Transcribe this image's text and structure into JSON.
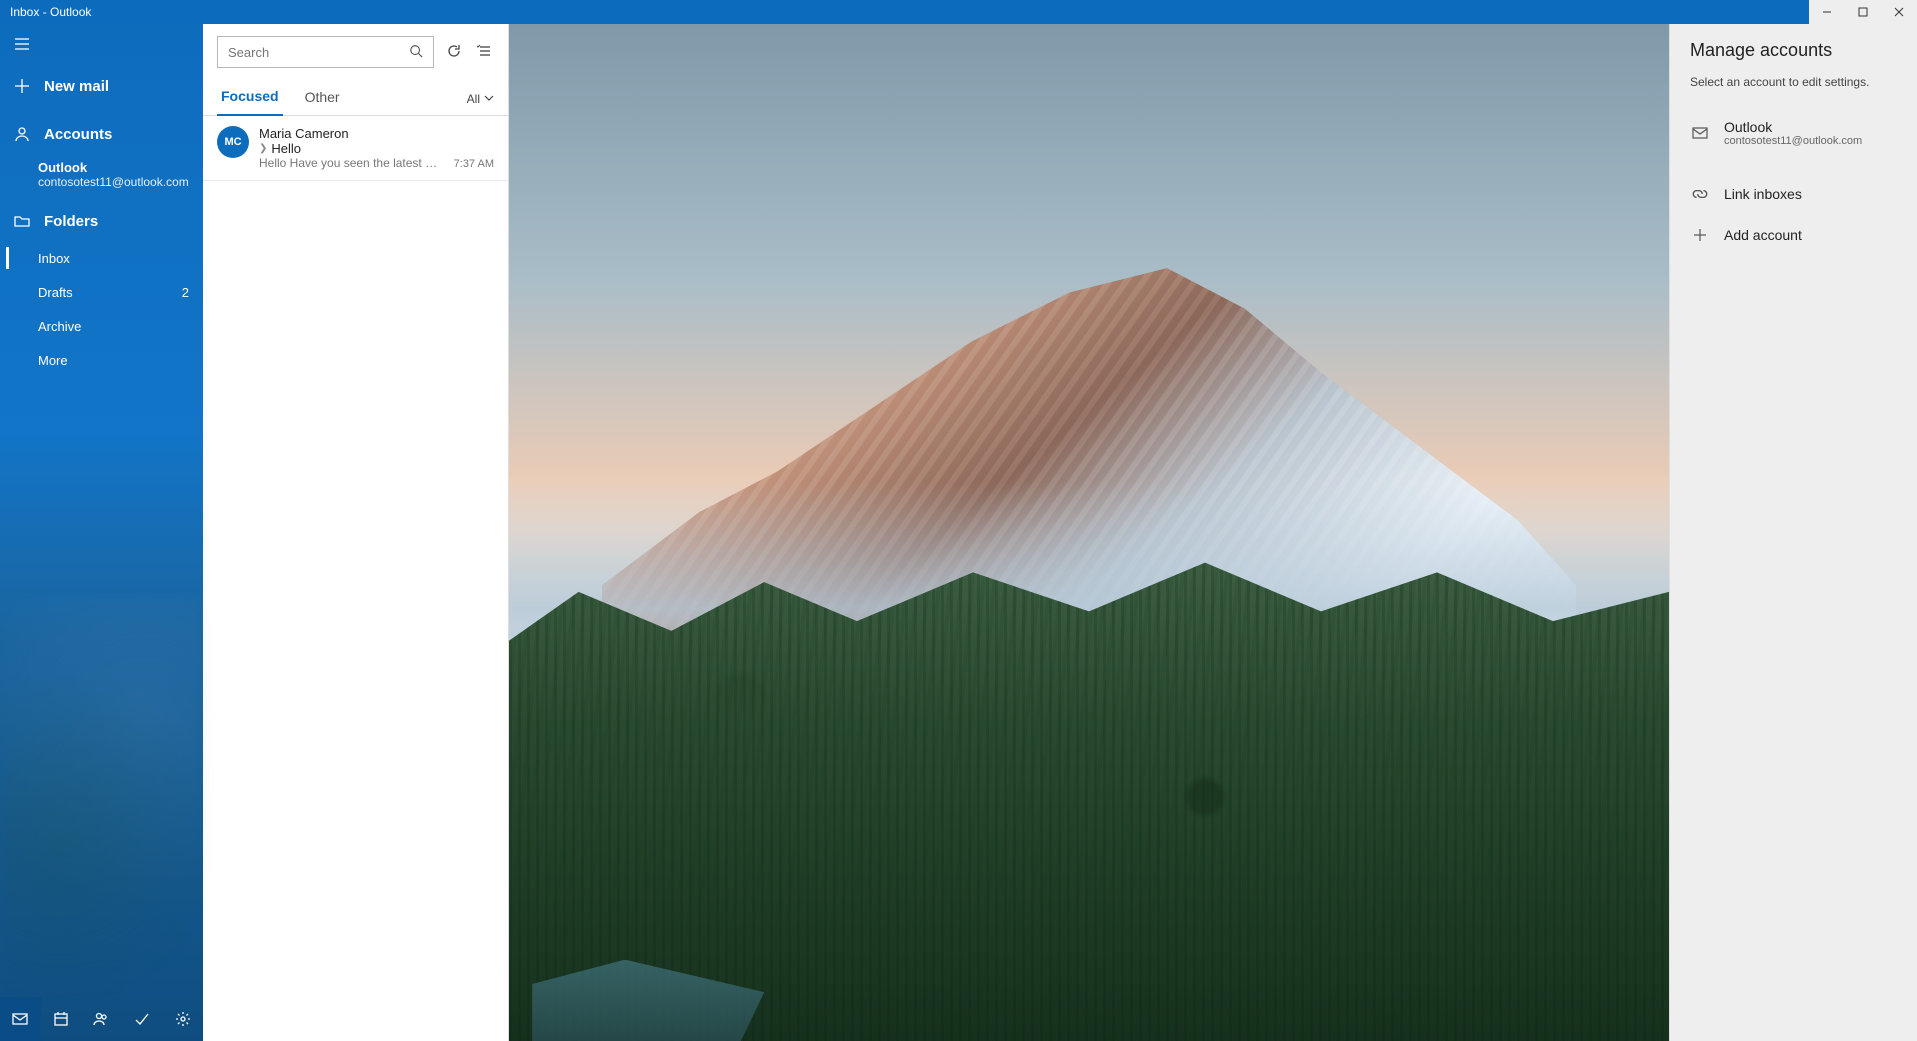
{
  "window": {
    "title": "Inbox - Outlook"
  },
  "nav": {
    "new_mail": "New mail",
    "accounts_header": "Accounts",
    "account_name": "Outlook",
    "account_email": "contosotest11@outlook.com",
    "folders_header": "Folders",
    "folders": {
      "inbox": "Inbox",
      "drafts": "Drafts",
      "drafts_count": "2",
      "archive": "Archive",
      "more": "More"
    }
  },
  "list": {
    "search_placeholder": "Search",
    "tab_focused": "Focused",
    "tab_other": "Other",
    "filter": "All",
    "email": {
      "initials": "MC",
      "from": "Maria Cameron",
      "subject": "Hello",
      "preview": "Hello Have you seen the latest new, ...",
      "time": "7:37 AM"
    }
  },
  "panel": {
    "title": "Manage accounts",
    "subtitle": "Select an account to edit settings.",
    "account_name": "Outlook",
    "account_email": "contosotest11@outlook.com",
    "link_inboxes": "Link inboxes",
    "add_account": "Add account"
  }
}
